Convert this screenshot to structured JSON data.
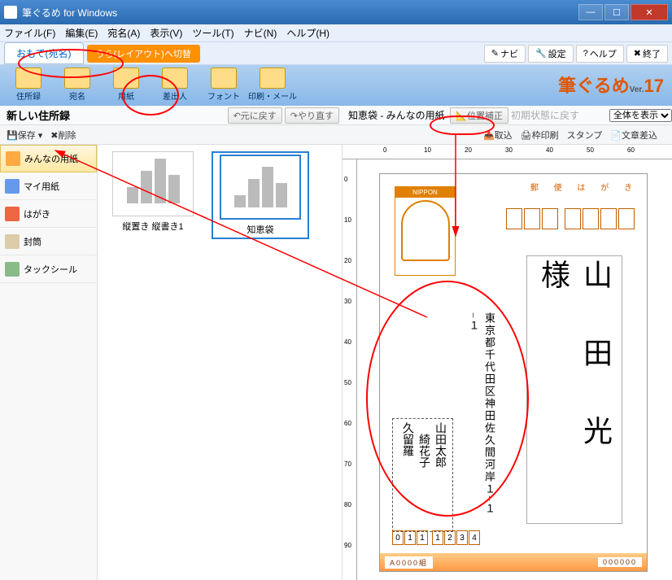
{
  "window": {
    "title": "筆ぐるめ for Windows"
  },
  "menu": {
    "file": "ファイル(F)",
    "edit": "編集(E)",
    "atena": "宛名(A)",
    "view": "表示(V)",
    "tool": "ツール(T)",
    "navi": "ナビ(N)",
    "help": "ヘルプ(H)"
  },
  "tabs": {
    "front": "おもて(宛名)",
    "back": "うら(レイアウト)へ切替"
  },
  "topbtns": {
    "navi": "ナビ",
    "settei": "設定",
    "help": "ヘルプ",
    "close": "終了"
  },
  "toolbar": {
    "jusho": "住所録",
    "atena": "宛名",
    "yoshi": "用紙",
    "sashidashi": "差出人",
    "font": "フォント",
    "insatsu": "印刷・メール"
  },
  "brand": {
    "name": "筆ぐるめ",
    "ver": "Ver.",
    "num": "17"
  },
  "sub": {
    "left_title": "新しい住所録",
    "undo": "元に戻す",
    "redo": "やり直す",
    "right_title": "知恵袋 - みんなの用紙",
    "ichihosei": "位置補正",
    "shoki": "初期状態に戻す",
    "zentai": "全体を表示"
  },
  "strip": {
    "hozon": "保存",
    "sakujo": "削除",
    "torikomi": "取込",
    "wakuin": "枠印刷",
    "stamp": "スタンプ",
    "bunsho": "文章差込"
  },
  "left": {
    "minna": "みんなの用紙",
    "my": "マイ用紙",
    "hagaki": "はがき",
    "futou": "封筒",
    "tack": "タックシール"
  },
  "thumbs": {
    "t1": "縦置き 縦書き1",
    "t2": "知恵袋"
  },
  "hagaki": {
    "nippon": "NIPPON",
    "header": "郵 便 は が き",
    "address": "東京都千代田区神田佐久間河岸１−１−１",
    "name": "山　田　光　様",
    "sender_name1": "山田太郎",
    "sender_name2": "綺花子",
    "sender_name3": "久留羅",
    "pc": [
      "0",
      "1",
      "1",
      "1",
      "2",
      "3",
      "4"
    ],
    "bottom1": "A0000組",
    "bottom2": "000000"
  }
}
